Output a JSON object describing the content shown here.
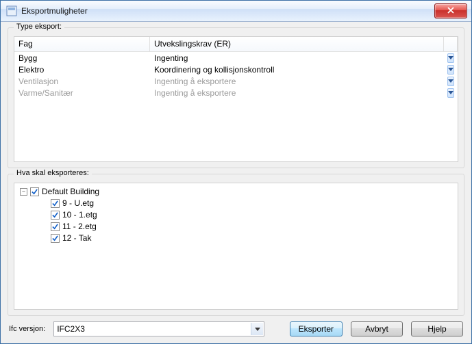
{
  "window": {
    "title": "Eksportmuligheter"
  },
  "type_export": {
    "legend": "Type eksport:",
    "columns": {
      "fag": "Fag",
      "er": "Utvekslingskrav (ER)"
    },
    "rows": [
      {
        "fag": "Bygg",
        "er": "Ingenting",
        "disabled": false
      },
      {
        "fag": "Elektro",
        "er": "Koordinering og kollisjonskontroll",
        "disabled": false
      },
      {
        "fag": "Ventilasjon",
        "er": "Ingenting å eksportere",
        "disabled": true
      },
      {
        "fag": "Varme/Sanitær",
        "er": "Ingenting å eksportere",
        "disabled": true
      }
    ]
  },
  "what_export": {
    "legend": "Hva skal eksporteres:",
    "tree": {
      "root": {
        "label": "Default Building",
        "checked": true,
        "expanded": true
      },
      "children": [
        {
          "label": "9 - U.etg",
          "checked": true
        },
        {
          "label": "10 - 1.etg",
          "checked": true
        },
        {
          "label": "11 - 2.etg",
          "checked": true
        },
        {
          "label": "12 - Tak",
          "checked": true
        }
      ]
    }
  },
  "bottom": {
    "version_label": "Ifc versjon:",
    "version_selected": "IFC2X3",
    "export_label": "Eksporter",
    "cancel_label": "Avbryt",
    "help_label": "Hjelp"
  }
}
